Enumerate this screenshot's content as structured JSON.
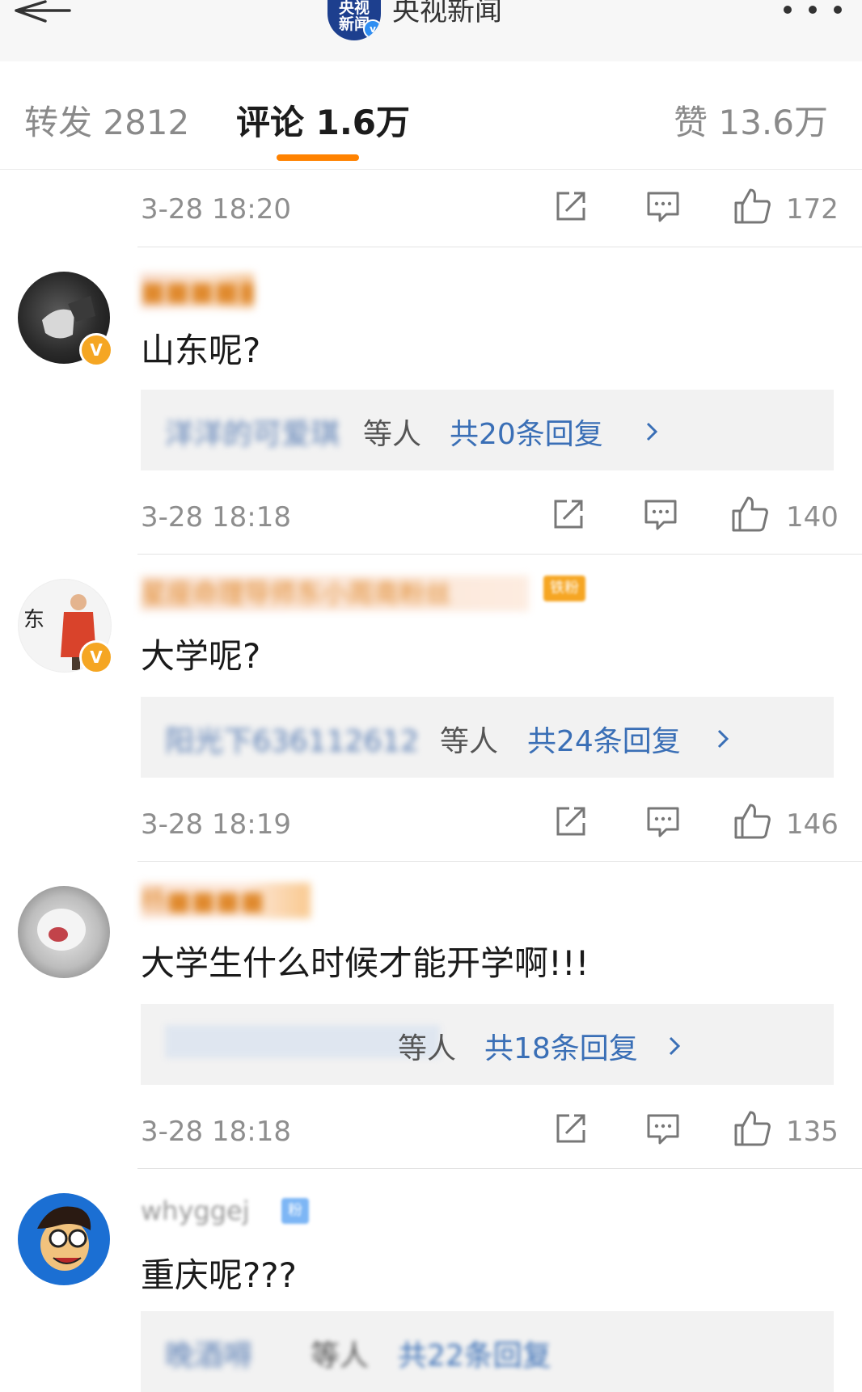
{
  "header": {
    "channel_logo_line1": "央视",
    "channel_logo_line2": "新闻",
    "verified_mark": "v",
    "channel_name": "央视新闻"
  },
  "tabs": {
    "repost": "转发 2812",
    "comment": "评论 1.6万",
    "like": "赞 13.6万",
    "active": "comment",
    "accent_color": "#ff8200"
  },
  "top_meta": {
    "time": "3-28 18:20",
    "likes": "172"
  },
  "comments": [
    {
      "username": "■■■■■",
      "verified_mark": "V",
      "text": "山东呢?",
      "reply_names": "洋洋的可爱琪",
      "reply_suffix": "等人",
      "reply_total": "共20条回复",
      "time": "3-28 18:18",
      "likes": "140"
    },
    {
      "username": "星座命理导师东小周南粉丝",
      "fan_badge": "铁粉",
      "verified_mark": "V",
      "text": "大学呢?",
      "reply_names": "阳光下636112612",
      "reply_suffix": "等人",
      "reply_total": "共24条回复",
      "time": "3-28 18:19",
      "likes": "146"
    },
    {
      "username": "杨■■■■",
      "text": "大学生什么时候才能开学啊!!!",
      "reply_names": "■■■■■■■■■■",
      "reply_suffix": "等人",
      "reply_total": "共18条回复",
      "time": "3-28 18:18",
      "likes": "135"
    },
    {
      "username": "whyggej",
      "fan_badge": "粉",
      "text": "重庆呢???",
      "reply_names": "晚酒嘚",
      "reply_suffix": "等人",
      "reply_total": "共22条回复"
    }
  ],
  "icons": {
    "back": "arrow-left-icon",
    "more": "more-dots-icon",
    "share": "share-icon",
    "reply": "comment-bubble-icon",
    "like": "thumbs-up-icon",
    "chevron": "chevron-right-icon"
  }
}
